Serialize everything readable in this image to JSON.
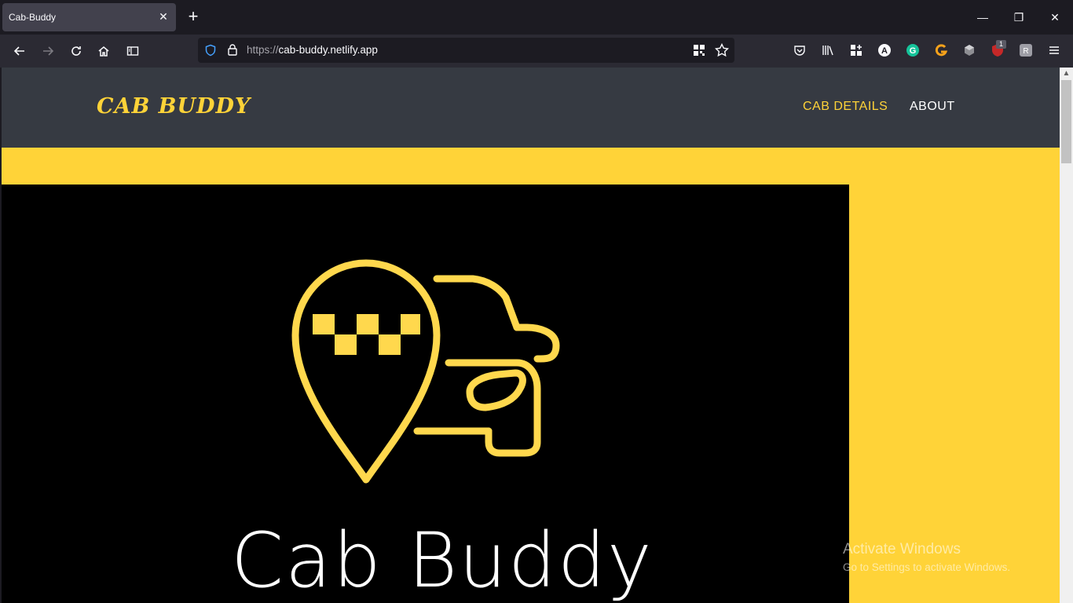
{
  "browser": {
    "tab_title": "Cab-Buddy",
    "tab_close": "✕",
    "new_tab": "+",
    "url_protocol": "https://",
    "url_host": "cab-buddy.netlify.app",
    "extension_badge": "1",
    "window_controls": {
      "minimize": "—",
      "restore": "❐",
      "close": "✕"
    }
  },
  "site": {
    "brand": "CAB BUDDY",
    "nav": [
      {
        "label": "CAB DETAILS",
        "color": "#ffd338"
      },
      {
        "label": "ABOUT",
        "color": "#ffffff"
      }
    ],
    "hero_title": "Cab Buddy",
    "accent_color": "#ffd338",
    "header_color": "#363a42"
  },
  "os_watermark": {
    "line1": "Activate Windows",
    "line2": "Go to Settings to activate Windows."
  }
}
